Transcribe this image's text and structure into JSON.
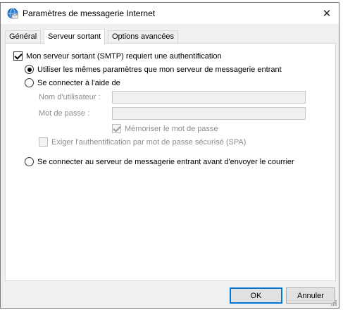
{
  "window": {
    "title": "Paramètres de messagerie Internet",
    "close_glyph": "✕",
    "icon": "mail-settings-icon"
  },
  "tabs": [
    {
      "label": "Général",
      "active": false
    },
    {
      "label": "Serveur sortant",
      "active": true
    },
    {
      "label": "Options avancées",
      "active": false
    }
  ],
  "outgoing": {
    "smtp_auth_label": "Mon serveur sortant (SMTP) requiert une authentification",
    "smtp_auth_checked": true,
    "same_settings_label": "Utiliser les mêmes paramètres que mon serveur de messagerie entrant",
    "login_with_label": "Se connecter à l'aide de",
    "username_label": "Nom d'utilisateur :",
    "username_value": "",
    "password_label": "Mot de passe :",
    "password_value": "",
    "remember_password_label": "Mémoriser le mot de passe",
    "spa_label": "Exiger l'authentification par mot de passe sécurisé (SPA)",
    "login_before_label": "Se connecter au serveur de messagerie entrant avant d'envoyer le courrier",
    "selected_option": "same_settings"
  },
  "buttons": {
    "ok": "OK",
    "cancel": "Annuler"
  },
  "colors": {
    "default_button_border": "#0078d7",
    "disabled_text": "#8c8c8c"
  }
}
